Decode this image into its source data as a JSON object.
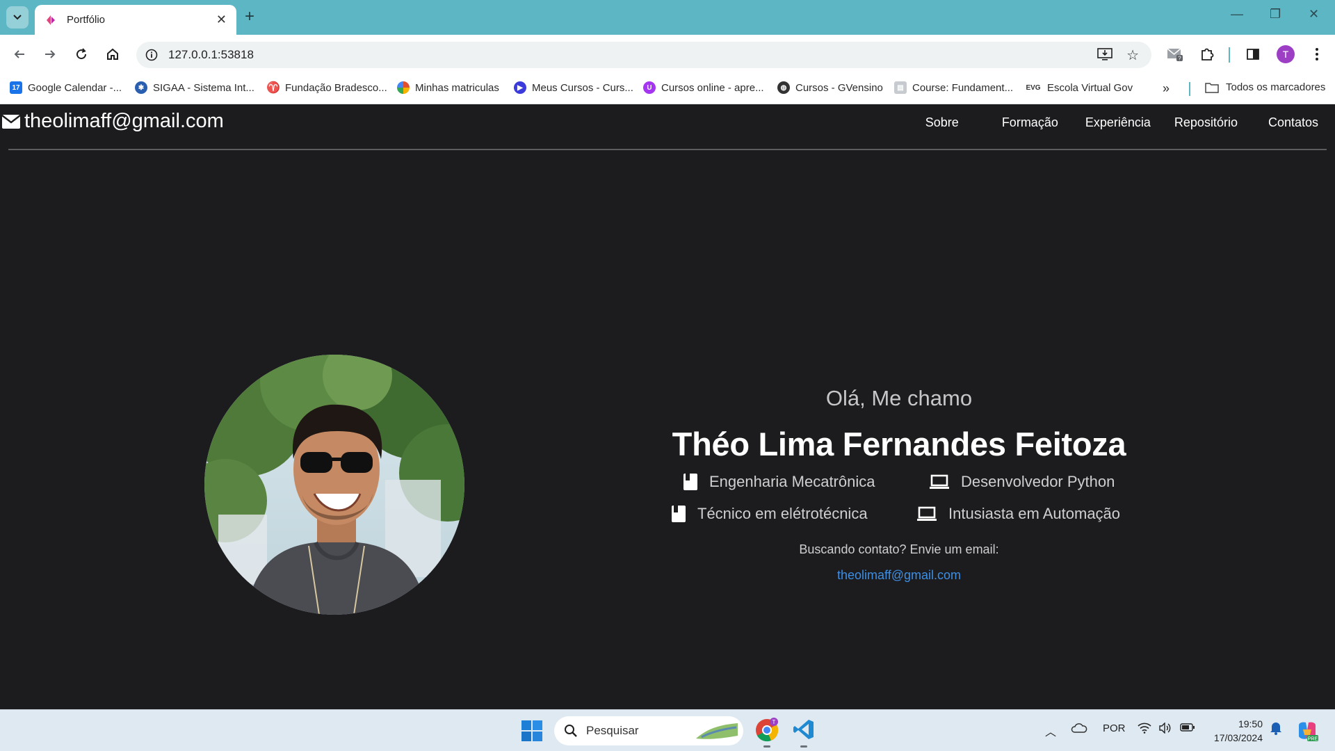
{
  "browser": {
    "tab_title": "Portfólio",
    "url": "127.0.0.1:53818",
    "bookmarks": [
      {
        "label": "Google Calendar -...",
        "icon": "calendar-icon",
        "color": "#1a73e8"
      },
      {
        "label": "SIGAA - Sistema Int...",
        "icon": "sigaa-icon",
        "color": "#2a5fb0"
      },
      {
        "label": "Fundação Bradesco...",
        "icon": "bradesco-icon",
        "color": "#cc1f36"
      },
      {
        "label": "Minhas matriculas",
        "icon": "matriculas-icon",
        "color": "#e04f2f"
      },
      {
        "label": "Meus Cursos - Curs...",
        "icon": "youtube-icon",
        "color": "#3b3bdc"
      },
      {
        "label": "Cursos online - apre...",
        "icon": "udemy-icon",
        "color": "#a435f0"
      },
      {
        "label": "Cursos - GVensino",
        "icon": "globe-icon",
        "color": "#333333"
      },
      {
        "label": "Course: Fundament...",
        "icon": "course-icon",
        "color": "#9aa0a6"
      },
      {
        "label": "Escola Virtual Gov",
        "icon": "evg-icon",
        "color": "#333333"
      }
    ],
    "all_bookmarks": "Todos os marcadores",
    "profile_initial": "T"
  },
  "page": {
    "brand_email": "theolimaff@gmail.com",
    "nav": [
      "Sobre",
      "Formação",
      "Experiência",
      "Repositório",
      "Contatos"
    ],
    "greeting": "Olá, Me chamo",
    "name": "Théo Lima Fernandes Feitoza",
    "skills": [
      {
        "label": "Engenharia Mecatrônica",
        "icon": "book-icon"
      },
      {
        "label": "Desenvolvedor Python",
        "icon": "laptop-icon"
      },
      {
        "label": "Técnico em elétrotécnica",
        "icon": "book-icon"
      },
      {
        "label": "Intusiasta em Automação",
        "icon": "laptop-icon"
      }
    ],
    "contact_text": "Buscando contato? Envie um email:",
    "contact_email": "theolimaff@gmail.com",
    "accent_color": "#3d8fe6"
  },
  "taskbar": {
    "search_placeholder": "Pesquisar",
    "language": "POR",
    "time": "19:50",
    "date": "17/03/2024"
  }
}
